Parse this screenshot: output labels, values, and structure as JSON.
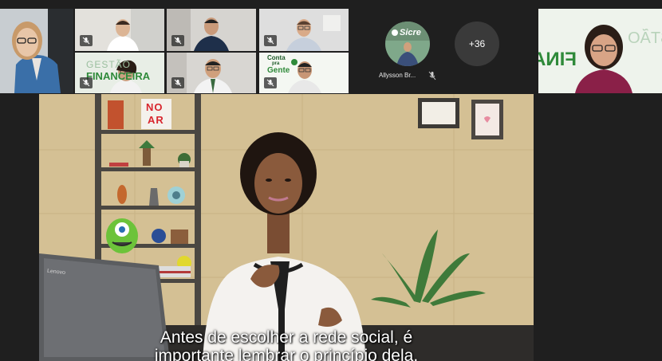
{
  "meeting": {
    "participant_name": "Allysson Br...",
    "more_count": "+36"
  },
  "tiles": {
    "logo_sicredi": "Sicre",
    "gestao_text": "GESTÃO",
    "financeira_text": "FINANCEIRA",
    "conta_text": "Conta",
    "pra_text": "pra",
    "gente_text": "Gente"
  },
  "video": {
    "sign_text_1": "NO",
    "sign_text_2": "AR",
    "laptop_brand": "Lenovo",
    "subtitle_line1": "Antes de escolher a rede social, é",
    "subtitle_line2": "importante lembrar o princípio dela."
  },
  "colors": {
    "brand_green": "#2f8a3a",
    "background": "#1f1f1f"
  }
}
